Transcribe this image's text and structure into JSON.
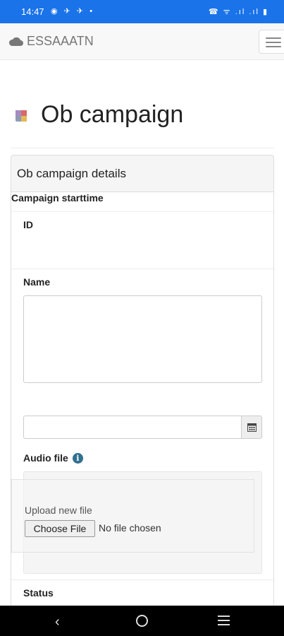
{
  "status_bar": {
    "time": "14:47",
    "left_icons": "◉ ✈ ✈ •",
    "right_icons": "☎ ᯤ .ıl .ıl ▮"
  },
  "navbar": {
    "brand": "ESSAAATN",
    "brand_icon": "cloud-icon",
    "menu_icon": "hamburger-menu-icon"
  },
  "page": {
    "title": "Ob campaign",
    "title_icon": "app-cube-icon"
  },
  "panel": {
    "heading": "Ob campaign details",
    "fields": {
      "id_label": "ID",
      "name_label": "Name",
      "name_value": "",
      "starttime_label": "Campaign starttime",
      "starttime_value": "",
      "audio_label": "Audio file",
      "audio_info_icon": "info-icon",
      "upload_label": "Upload new file",
      "choose_button": "Choose File",
      "no_file_text": "No file chosen",
      "status_label": "Status"
    }
  },
  "android_nav": {
    "back_icon": "back-chevron-icon",
    "home_icon": "home-circle-icon",
    "recent_icon": "recents-menu-icon"
  },
  "colors": {
    "status_bar": "#1a73e8",
    "info_icon": "#31708f"
  }
}
